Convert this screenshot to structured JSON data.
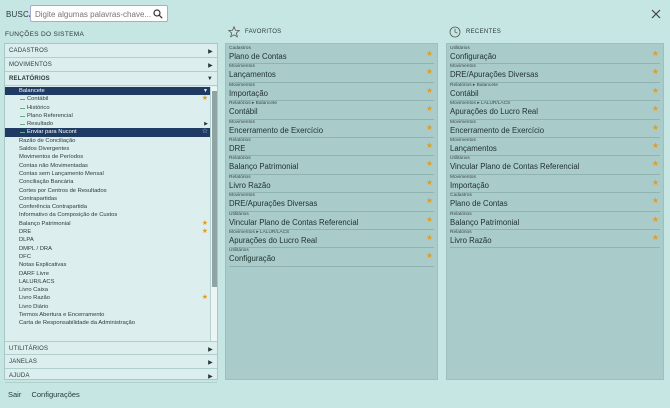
{
  "header": {
    "busca_label": "BUSCA",
    "search_placeholder": "Digite algumas palavras-chave..."
  },
  "funcoes_title": "FUNÇÕES DO SISTEMA",
  "sections": {
    "cadastros": "CADASTROS",
    "movimentos": "MOVIMENTOS",
    "relatorios": "RELATÓRIOS",
    "utilitarios": "UTILITÁRIOS",
    "janelas": "JANELAS",
    "ajuda": "AJUDA"
  },
  "tree": [
    {
      "label": "Balancete",
      "level": 1,
      "selected": true,
      "icon": "triangle-down"
    },
    {
      "label": "Contábil",
      "level": 2,
      "icon": "star-filled"
    },
    {
      "label": "Histórico",
      "level": 2
    },
    {
      "label": "Plano Referencial",
      "level": 2
    },
    {
      "label": "Resultado",
      "level": 2,
      "icon": "triangle-right"
    },
    {
      "label": "Enviar para Nucont",
      "level": 2,
      "selected": true,
      "icon": "star-outline"
    },
    {
      "label": "Razão de Conciliação",
      "level": 1
    },
    {
      "label": "Saldos Divergentes",
      "level": 1
    },
    {
      "label": "Movimentos de Períodos",
      "level": 1
    },
    {
      "label": "Contas não Movimentadas",
      "level": 1
    },
    {
      "label": "Contas sem Lançamento Mensal",
      "level": 1
    },
    {
      "label": "Conciliação Bancária",
      "level": 1
    },
    {
      "label": "Cortes por Centros de Resultados",
      "level": 1
    },
    {
      "label": "Contrapartidas",
      "level": 1
    },
    {
      "label": "Conferência Contrapartida",
      "level": 1
    },
    {
      "label": "Informativo da Composição de Custos",
      "level": 1
    },
    {
      "label": "Balanço Patrimonial",
      "level": 1,
      "icon": "star-filled"
    },
    {
      "label": "DRE",
      "level": 1,
      "icon": "star-filled"
    },
    {
      "label": "DLPA",
      "level": 1
    },
    {
      "label": "DMPL / DRA",
      "level": 1
    },
    {
      "label": "DFC",
      "level": 1
    },
    {
      "label": "Notas Explicativas",
      "level": 1
    },
    {
      "label": "DARF Livre",
      "level": 1
    },
    {
      "label": "LALUR/LACS",
      "level": 1
    },
    {
      "label": "Livro Caixa",
      "level": 1
    },
    {
      "label": "Livro Razão",
      "level": 1,
      "icon": "star-filled"
    },
    {
      "label": "Livro Diário",
      "level": 1
    },
    {
      "label": "Termos Abertura e Encerramento",
      "level": 1
    },
    {
      "label": "Carta de Responsabilidade da Administração",
      "level": 1
    }
  ],
  "favoritos": {
    "title": "FAVORITOS",
    "items": [
      {
        "cat": "Cadastros",
        "name": "Plano de Contas"
      },
      {
        "cat": "Movimentos",
        "name": "Lançamentos"
      },
      {
        "cat": "Movimentos",
        "name": "Importação"
      },
      {
        "cat": "Relatórios ▸ Balancete",
        "name": "Contábil"
      },
      {
        "cat": "Movimentos",
        "name": "Encerramento de Exercício"
      },
      {
        "cat": "Relatórios",
        "name": "DRE"
      },
      {
        "cat": "Relatórios",
        "name": "Balanço Patrimonial"
      },
      {
        "cat": "Relatórios",
        "name": "Livro Razão"
      },
      {
        "cat": "Movimentos",
        "name": "DRE/Apurações Diversas"
      },
      {
        "cat": "Utilitários",
        "name": "Vincular Plano de Contas Referencial"
      },
      {
        "cat": "Movimentos ▸ LALUR/LACS",
        "name": "Apurações do Lucro Real"
      },
      {
        "cat": "Utilitários",
        "name": "Configuração"
      }
    ]
  },
  "recentes": {
    "title": "RECENTES",
    "items": [
      {
        "cat": "Utilitários",
        "name": "Configuração"
      },
      {
        "cat": "Movimentos",
        "name": "DRE/Apurações Diversas"
      },
      {
        "cat": "Relatórios ▸ Balancete",
        "name": "Contábil"
      },
      {
        "cat": "Movimentos ▸ LALUR/LACS",
        "name": "Apurações do Lucro Real"
      },
      {
        "cat": "Movimentos",
        "name": "Encerramento de Exercício"
      },
      {
        "cat": "Movimentos",
        "name": "Lançamentos"
      },
      {
        "cat": "Utilitários",
        "name": "Vincular Plano de Contas Referencial"
      },
      {
        "cat": "Movimentos",
        "name": "Importação"
      },
      {
        "cat": "Cadastros",
        "name": "Plano de Contas"
      },
      {
        "cat": "Relatórios",
        "name": "Balanço Patrimonial"
      },
      {
        "cat": "Relatórios",
        "name": "Livro Razão"
      }
    ]
  },
  "footer": {
    "sair": "Sair",
    "configuracoes": "Configurações"
  },
  "colors": {
    "background": "#c6e6e3",
    "panel": "#a9ccca",
    "selected": "#1f3b63",
    "star": "#e59b1c"
  }
}
